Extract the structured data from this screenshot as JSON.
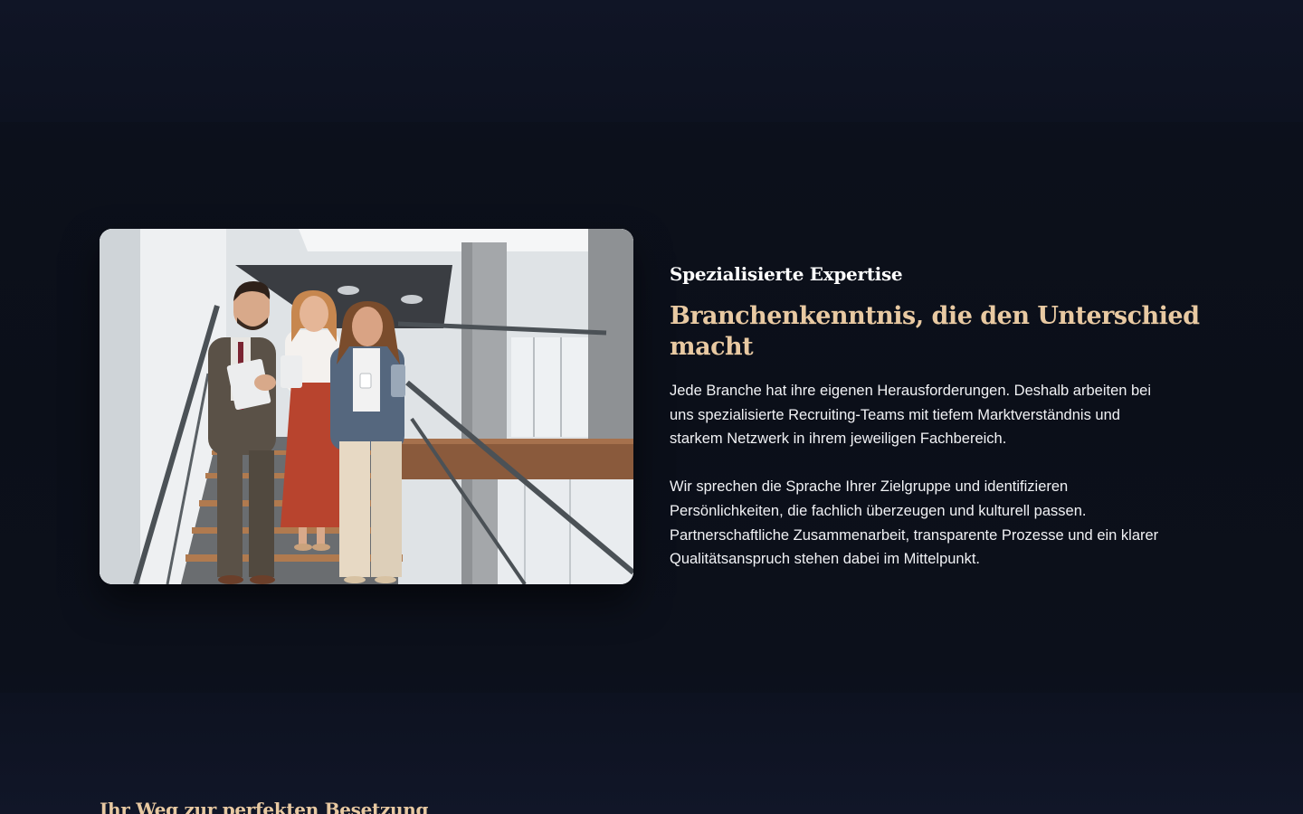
{
  "expertise_section": {
    "image": {
      "alt": "Drei Geschäftsleute gehen eine Treppe hinunter",
      "colors": {
        "wall": "#dfe3e6",
        "ceiling_dark": "#3a3d42",
        "column": "#a4a7aa",
        "rail": "#4b5156",
        "wood": "#8a5a3c",
        "suit": "#5a5147",
        "skirt": "#b8442e",
        "blazer": "#55677e",
        "pants": "#e7d9c4"
      }
    },
    "eyebrow": "Spezialisierte Expertise",
    "heading": "Branchenkenntnis, die den Unterschied macht",
    "paragraph_1": "Jede Branche hat ihre eigenen Herausforderungen. Deshalb arbeiten bei\nuns spezialisierte Recruiting-Teams mit tiefem Marktverständnis und\nstarkem Netzwerk in ihrem jeweiligen Fachbereich.",
    "paragraph_2": "Wir sprechen die Sprache Ihrer Zielgruppe und identifizieren\nPersönlichkeiten, die fachlich überzeugen und kulturell passen.\nPartnerschaftliche Zusammenarbeit, transparente Prozesse und ein klarer\nQualitätsanspruch stehen dabei im Mittelpunkt."
  },
  "process_section": {
    "title": "Ihr Weg zur perfekten Besetzung"
  },
  "theme": {
    "background": "#0c101b",
    "accent": "#e8c9a2",
    "text": "#f1f2f5"
  }
}
